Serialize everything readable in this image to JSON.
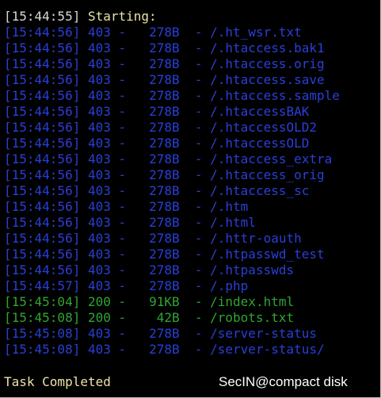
{
  "header": {
    "timestamp": "[15:44:55]",
    "message": "Starting:"
  },
  "results": [
    {
      "time": "[15:44:56]",
      "status": "403",
      "size": "278B",
      "path": "/.ht_wsr.txt",
      "color": "#2a3fd6"
    },
    {
      "time": "[15:44:56]",
      "status": "403",
      "size": "278B",
      "path": "/.htaccess.bak1",
      "color": "#2a3fd6"
    },
    {
      "time": "[15:44:56]",
      "status": "403",
      "size": "278B",
      "path": "/.htaccess.orig",
      "color": "#2a3fd6"
    },
    {
      "time": "[15:44:56]",
      "status": "403",
      "size": "278B",
      "path": "/.htaccess.save",
      "color": "#2a3fd6"
    },
    {
      "time": "[15:44:56]",
      "status": "403",
      "size": "278B",
      "path": "/.htaccess.sample",
      "color": "#2a3fd6"
    },
    {
      "time": "[15:44:56]",
      "status": "403",
      "size": "278B",
      "path": "/.htaccessBAK",
      "color": "#2a3fd6"
    },
    {
      "time": "[15:44:56]",
      "status": "403",
      "size": "278B",
      "path": "/.htaccessOLD2",
      "color": "#2a3fd6"
    },
    {
      "time": "[15:44:56]",
      "status": "403",
      "size": "278B",
      "path": "/.htaccessOLD",
      "color": "#2a3fd6"
    },
    {
      "time": "[15:44:56]",
      "status": "403",
      "size": "278B",
      "path": "/.htaccess_extra",
      "color": "#2a3fd6"
    },
    {
      "time": "[15:44:56]",
      "status": "403",
      "size": "278B",
      "path": "/.htaccess_orig",
      "color": "#2a3fd6"
    },
    {
      "time": "[15:44:56]",
      "status": "403",
      "size": "278B",
      "path": "/.htaccess_sc",
      "color": "#2a3fd6"
    },
    {
      "time": "[15:44:56]",
      "status": "403",
      "size": "278B",
      "path": "/.htm",
      "color": "#2a3fd6"
    },
    {
      "time": "[15:44:56]",
      "status": "403",
      "size": "278B",
      "path": "/.html",
      "color": "#2a3fd6"
    },
    {
      "time": "[15:44:56]",
      "status": "403",
      "size": "278B",
      "path": "/.httr-oauth",
      "color": "#2a3fd6"
    },
    {
      "time": "[15:44:56]",
      "status": "403",
      "size": "278B",
      "path": "/.htpasswd_test",
      "color": "#2a3fd6"
    },
    {
      "time": "[15:44:56]",
      "status": "403",
      "size": "278B",
      "path": "/.htpasswds",
      "color": "#2a3fd6"
    },
    {
      "time": "[15:44:57]",
      "status": "403",
      "size": "278B",
      "path": "/.php",
      "color": "#2a3fd6"
    },
    {
      "time": "[15:45:04]",
      "status": "200",
      "size": "91KB",
      "path": "/index.html",
      "color": "#2ea534"
    },
    {
      "time": "[15:45:08]",
      "status": "200",
      "size": "42B",
      "path": "/robots.txt",
      "color": "#2ea534"
    },
    {
      "time": "[15:45:08]",
      "status": "403",
      "size": "278B",
      "path": "/server-status",
      "color": "#2a3fd6"
    },
    {
      "time": "[15:45:08]",
      "status": "403",
      "size": "278B",
      "path": "/server-status/",
      "color": "#2a3fd6"
    }
  ],
  "separator": "-",
  "footer": {
    "status": "Task Completed",
    "watermark": "SecIN@compact disk"
  },
  "colors": {
    "background": "#000000",
    "forbidden": "#2a3fd6",
    "ok": "#2ea534",
    "header_timestamp": "#d8d8d8",
    "header_message": "#e9e4a8",
    "watermark": "#ffffff"
  }
}
